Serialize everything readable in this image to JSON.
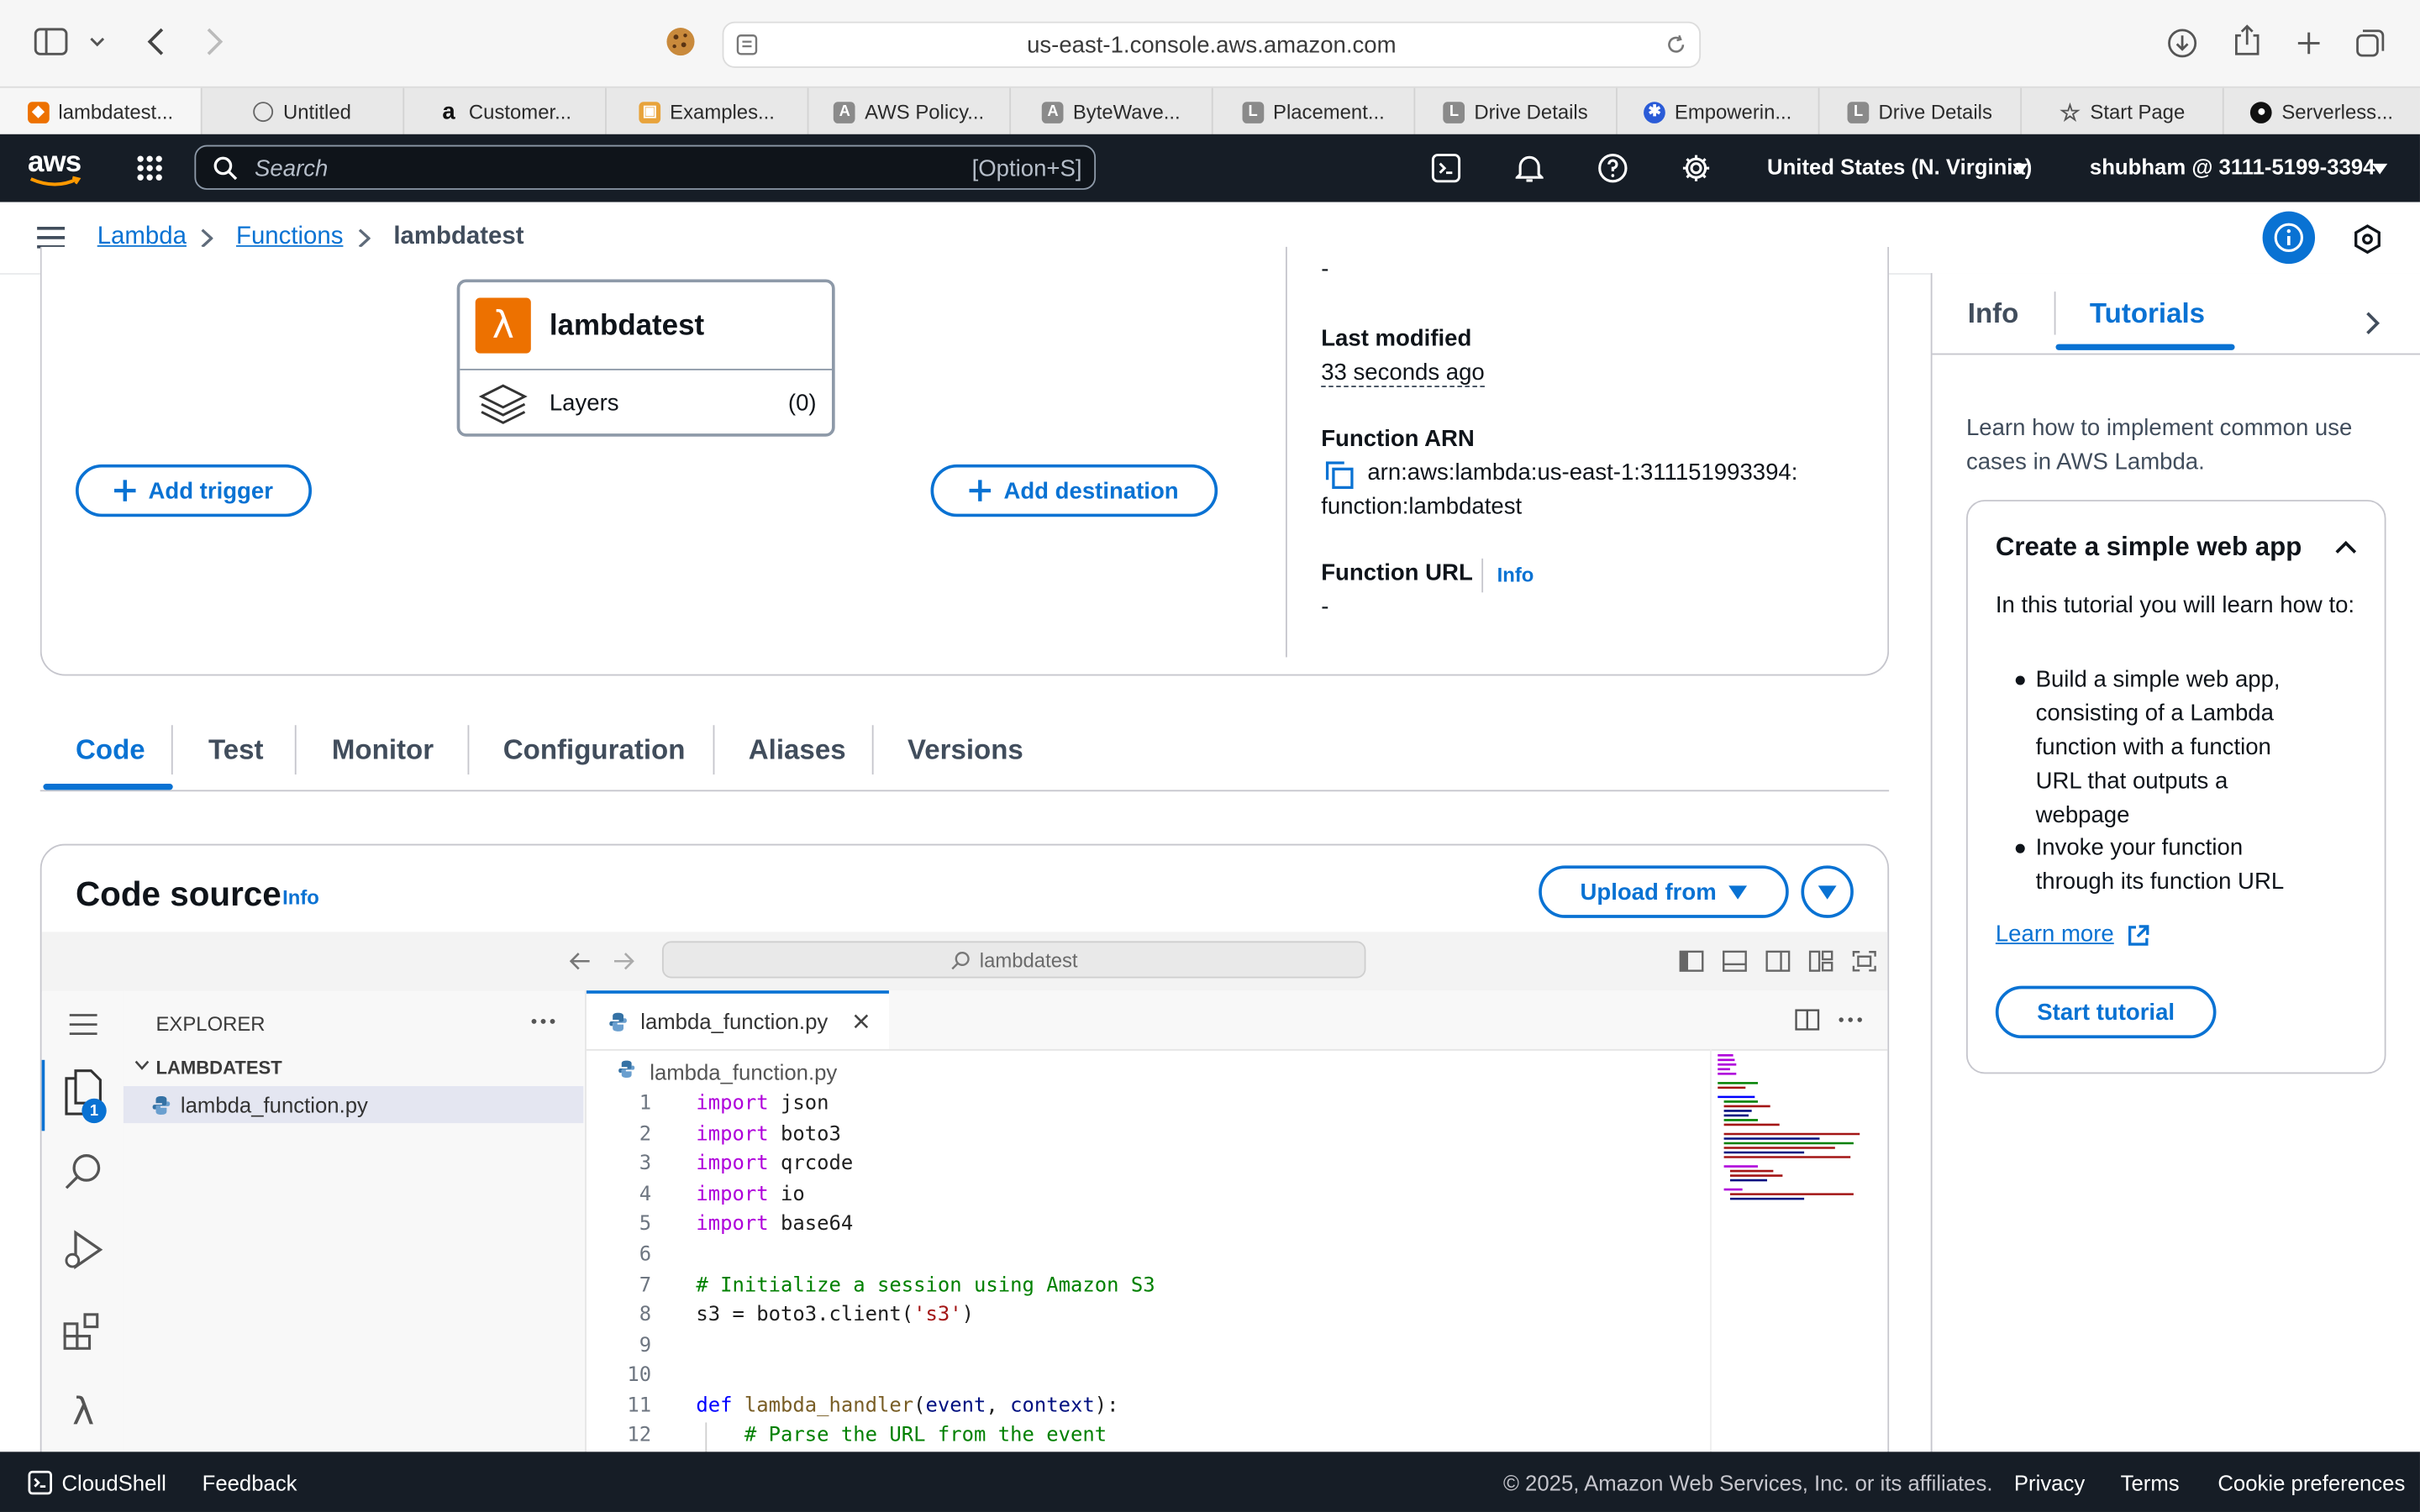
{
  "browser": {
    "url": "us-east-1.console.aws.amazon.com",
    "tabs": [
      {
        "label": "lambdatest..."
      },
      {
        "label": "Untitled"
      },
      {
        "label": "Customer..."
      },
      {
        "label": "Examples..."
      },
      {
        "label": "AWS Policy..."
      },
      {
        "label": "ByteWave..."
      },
      {
        "label": "Placement..."
      },
      {
        "label": "Drive Details"
      },
      {
        "label": "Empowerin..."
      },
      {
        "label": "Drive Details"
      },
      {
        "label": "Start Page"
      },
      {
        "label": "Serverless..."
      }
    ]
  },
  "topnav": {
    "logo": "aws",
    "search_placeholder": "Search",
    "search_shortcut": "[Option+S]",
    "region": "United States (N. Virginia)",
    "account": "shubham @ 3111-5199-3394"
  },
  "breadcrumb": {
    "items": [
      "Lambda",
      "Functions"
    ],
    "current": "lambdatest"
  },
  "overview": {
    "function_name": "lambdatest",
    "layers_label": "Layers",
    "layers_count": "(0)",
    "add_trigger": "Add trigger",
    "add_destination": "Add destination",
    "description_value": "-",
    "last_modified_label": "Last modified",
    "last_modified_value": "33 seconds ago",
    "arn_label": "Function ARN",
    "arn_line1": "arn:aws:lambda:us-east-1:311151993394:",
    "arn_line2": "function:lambdatest",
    "url_label": "Function URL",
    "url_info": "Info",
    "url_value": "-"
  },
  "main_tabs": [
    "Code",
    "Test",
    "Monitor",
    "Configuration",
    "Aliases",
    "Versions"
  ],
  "code_source": {
    "title": "Code source",
    "info": "Info",
    "upload_label": "Upload from",
    "command_center": "lambdatest",
    "explorer_title": "EXPLORER",
    "folder": "LAMBDATEST",
    "file": "lambda_function.py",
    "badge": "1",
    "editor_tab": "lambda_function.py",
    "editor_breadcrumb": "lambda_function.py",
    "lines": [
      "import json",
      "import boto3",
      "import qrcode",
      "import io",
      "import base64",
      "",
      "# Initialize a session using Amazon S3",
      "s3 = boto3.client('s3')",
      "",
      "",
      "def lambda_handler(event, context):",
      "    # Parse the URL from the event"
    ]
  },
  "help_panel": {
    "tab_info": "Info",
    "tab_tutorials": "Tutorials",
    "intro": "Learn how to implement common use cases in AWS Lambda.",
    "card_title": "Create a simple web app",
    "card_intro": "In this tutorial you will learn how to:",
    "bullets": [
      "Build a simple web app, consisting of a Lambda function with a function URL that outputs a webpage",
      "Invoke your function through its function URL"
    ],
    "learn_more": "Learn more",
    "start_tutorial": "Start tutorial"
  },
  "footer": {
    "cloudshell": "CloudShell",
    "feedback": "Feedback",
    "copyright": "© 2025, Amazon Web Services, Inc. or its affiliates.",
    "privacy": "Privacy",
    "terms": "Terms",
    "cookies": "Cookie preferences"
  },
  "colors": {
    "aws_nav": "#161d26",
    "link_blue": "#0972d3",
    "lambda_orange": "#ed7100"
  }
}
